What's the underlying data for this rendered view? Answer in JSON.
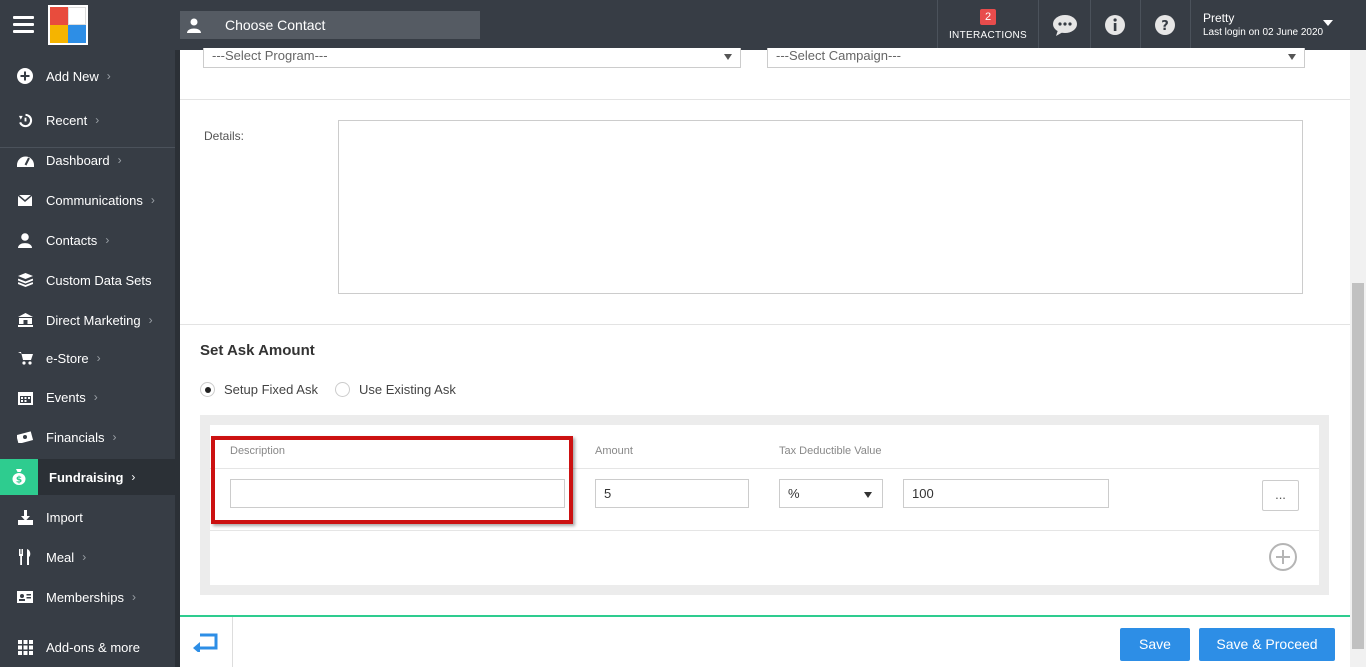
{
  "topbar": {
    "contact_placeholder": "Choose Contact",
    "interactions_count": "2",
    "interactions_label": "INTERACTIONS",
    "user_name": "Pretty",
    "last_login": "Last login on 02 June 2020",
    "icons": [
      "menu-icon",
      "person-icon",
      "chat-icon",
      "info-icon",
      "help-icon",
      "caret-down-icon"
    ]
  },
  "sidebar": {
    "items": [
      {
        "label": "Add New",
        "icon": "plus-circle-icon",
        "chevron": "›"
      },
      {
        "label": "Recent",
        "icon": "history-icon",
        "chevron": "›"
      },
      {
        "label": "Dashboard",
        "icon": "dashboard-icon",
        "chevron": "›"
      },
      {
        "label": "Communications",
        "icon": "envelope-icon",
        "chevron": "›"
      },
      {
        "label": "Contacts",
        "icon": "person-icon",
        "chevron": "›"
      },
      {
        "label": "Custom Data Sets",
        "icon": "layers-icon",
        "chevron": ""
      },
      {
        "label": "Direct Marketing",
        "icon": "bank-icon",
        "chevron": "›"
      },
      {
        "label": "e-Store",
        "icon": "cart-icon",
        "chevron": "›"
      },
      {
        "label": "Events",
        "icon": "calendar-icon",
        "chevron": "›"
      },
      {
        "label": "Financials",
        "icon": "money-icon",
        "chevron": "›"
      },
      {
        "label": "Fundraising",
        "icon": "money-bag-icon",
        "chevron": "›"
      },
      {
        "label": "Import",
        "icon": "download-icon",
        "chevron": ""
      },
      {
        "label": "Meal",
        "icon": "utensils-icon",
        "chevron": "›"
      },
      {
        "label": "Memberships",
        "icon": "id-card-icon",
        "chevron": "›"
      },
      {
        "label": "Add-ons & more",
        "icon": "grid-icon",
        "chevron": ""
      }
    ],
    "active": "Fundraising",
    "accent": "#2ecc8f"
  },
  "form": {
    "program_select": "---Select Program---",
    "campaign_select": "---Select Campaign---",
    "details_label": "Details:",
    "details_value": "",
    "section_title": "Set Ask Amount",
    "radio_fixed": "Setup Fixed Ask",
    "radio_existing": "Use Existing Ask",
    "radio_selected": "Setup Fixed Ask",
    "table": {
      "headers": {
        "description": "Description",
        "amount": "Amount",
        "tax": "Tax Deductible Value"
      },
      "row": {
        "description": "",
        "amount": "5",
        "tax_type": "%",
        "tax_value": "100",
        "more": "..."
      }
    }
  },
  "footer": {
    "save_label": "Save",
    "save_proceed_label": "Save & Proceed",
    "button_color": "#2d8ee6"
  }
}
